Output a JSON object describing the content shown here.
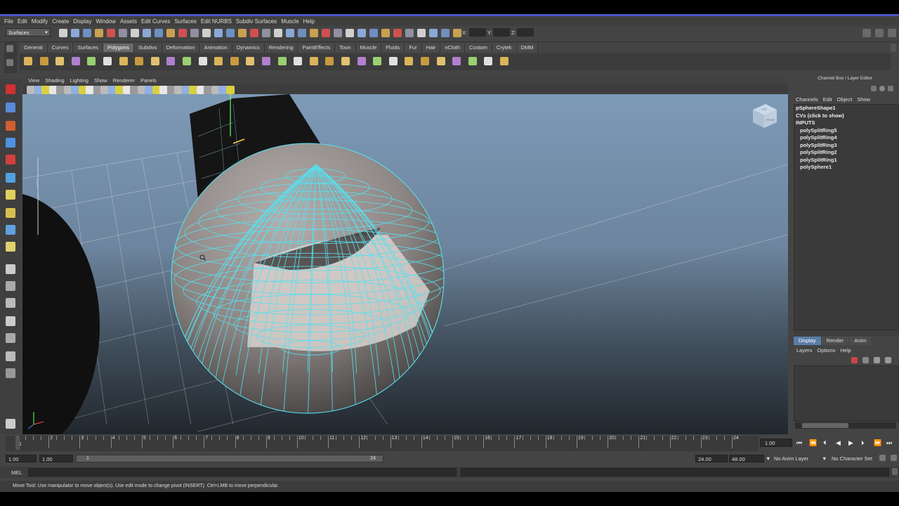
{
  "menubar": [
    "File",
    "Edit",
    "Modify",
    "Create",
    "Display",
    "Window",
    "Assets",
    "Edit Curves",
    "Surfaces",
    "Edit NURBS",
    "Subdiv Surfaces",
    "Muscle",
    "Help"
  ],
  "status": {
    "mode": "Surfaces",
    "x_label": "X:",
    "y_label": "Y:",
    "z_label": "Z:"
  },
  "shelf_tabs": [
    "General",
    "Curves",
    "Surfaces",
    "Polygons",
    "Subdivs",
    "Deformation",
    "Animation",
    "Dynamics",
    "Rendering",
    "PaintEffects",
    "Toon",
    "Muscle",
    "Fluids",
    "Fur",
    "Hair",
    "nCloth",
    "Custom",
    "Crytek",
    "DMM"
  ],
  "shelf_active": "Polygons",
  "viewport_menu": [
    "View",
    "Shading",
    "Lighting",
    "Show",
    "Renderer",
    "Panels"
  ],
  "viewcube": {
    "top": "TOP",
    "front": "FRONT"
  },
  "channel_box": {
    "title": "Channel Box / Layer Editor",
    "menu": [
      "Channels",
      "Edit",
      "Object",
      "Show"
    ],
    "object": "pSphereShape1",
    "cvs": "CVs (click to show)",
    "inputs_header": "INPUTS",
    "inputs": [
      "polySplitRing5",
      "polySplitRing4",
      "polySplitRing3",
      "polySplitRing2",
      "polySplitRing1",
      "polySphere1"
    ]
  },
  "layer_editor": {
    "tabs": [
      "Display",
      "Render",
      "Anim"
    ],
    "active": "Display",
    "menu": [
      "Layers",
      "Options",
      "Help"
    ]
  },
  "timeline": {
    "ticks": [
      "1",
      "2",
      "3",
      "4",
      "5",
      "6",
      "7",
      "8",
      "9",
      "10",
      "11",
      "12",
      "13",
      "14",
      "15",
      "16",
      "17",
      "18",
      "19",
      "20",
      "21",
      "22",
      "23",
      "24"
    ],
    "current_frame": "1.00"
  },
  "range": {
    "start": "1.00",
    "start_inner": "1.00",
    "bar_left": "1",
    "bar_right": "24",
    "end_inner": "24.00",
    "end": "48.00",
    "anim_layer": "No Anim Layer",
    "character_set": "No Character Set"
  },
  "mel_label": "MEL",
  "help_line": "Move Tool: Use manipulator to move object(s). Use edit mode to change pivot (INSERT). Ctrl+LMB to move perpendicular.",
  "colors": {
    "accent_blue": "#4a56c8",
    "wire_cyan": "#58e0f0",
    "tab_active": "#5a7ea6"
  }
}
